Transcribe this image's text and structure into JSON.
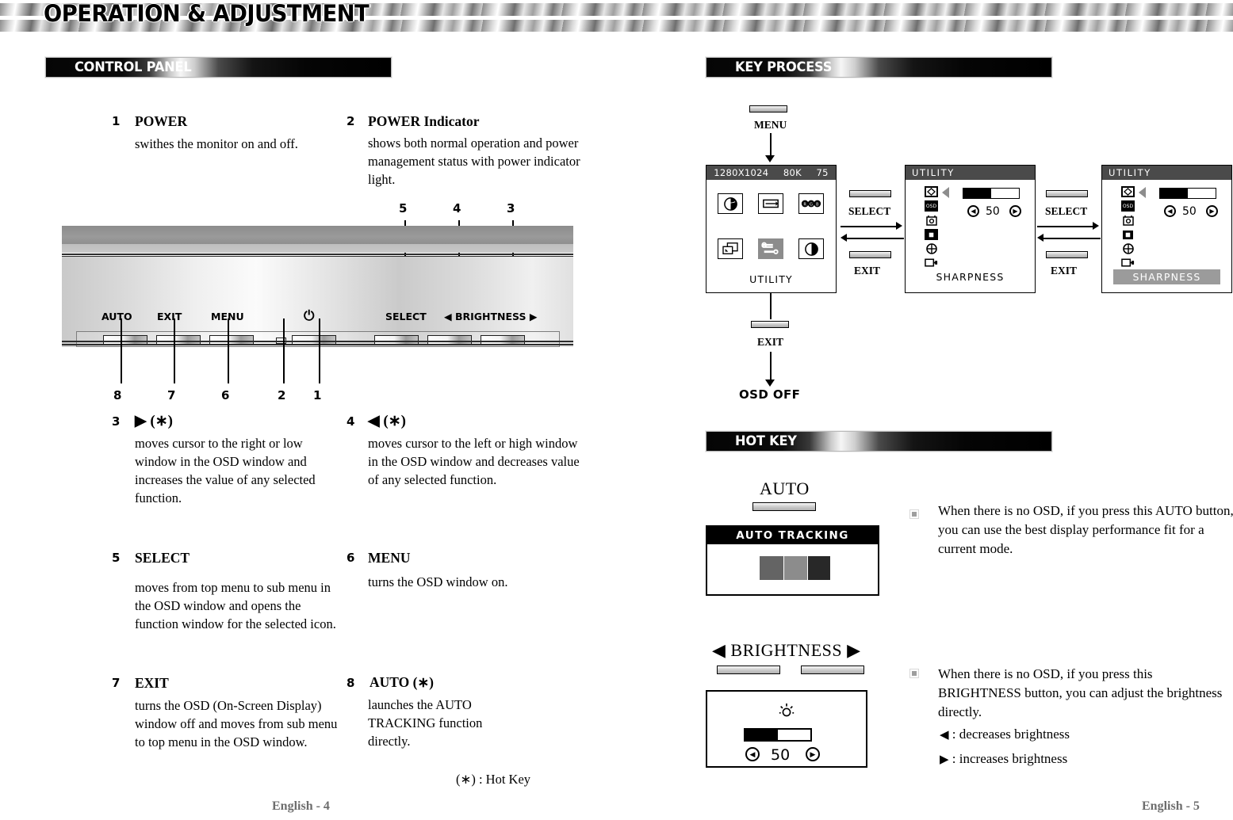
{
  "document": {
    "title": "OPERATION & ADJUSTMENT",
    "left_footer": "English - 4",
    "right_footer": "English - 5"
  },
  "sections": {
    "control_panel": "CONTROL PANEL",
    "key_process": "KEY PROCESS",
    "hot_key": "HOT KEY"
  },
  "control_panel": {
    "items": [
      {
        "num": "1",
        "title": "POWER",
        "body": "swithes the monitor on and off."
      },
      {
        "num": "2",
        "title": "POWER Indicator",
        "body": "shows both normal operation and power management status with power indicator light."
      },
      {
        "num": "3",
        "title": "▶  (∗)",
        "body": "moves cursor to the right  or low window in the OSD window and  increases the value of any selected function."
      },
      {
        "num": "4",
        "title": "◀  (∗)",
        "body": "moves cursor to the left or high window in the OSD window and  decreases value of any selected  function."
      },
      {
        "num": "5",
        "title": "SELECT",
        "body": "moves from top menu to sub menu in the OSD window and opens the function window for the selected icon."
      },
      {
        "num": "6",
        "title": "MENU",
        "body": "turns the OSD window on."
      },
      {
        "num": "7",
        "title": "EXIT",
        "body": "turns the OSD (On-Screen Display) window off and moves from sub menu to top menu in the OSD window."
      },
      {
        "num": "8",
        "title": "AUTO  (∗)",
        "body": "launches the AUTO TRACKING function directly."
      }
    ],
    "hotkey_legend": "(∗) : Hot Key",
    "bezel_labels": [
      "AUTO",
      "EXIT",
      "MENU",
      "⏻",
      "SELECT",
      "◀  BRIGHTNESS  ▶"
    ],
    "callout_top": [
      "5",
      "4",
      "3"
    ],
    "callout_bottom": [
      "8",
      "7",
      "6",
      "2",
      "1"
    ]
  },
  "key_process": {
    "entry_key": "MENU",
    "exit_key": "EXIT",
    "osd_off": "OSD OFF",
    "transition_forward": "SELECT",
    "transition_back": "EXIT",
    "main_menu": {
      "status_resolution": "1280X1024",
      "status_hfreq": "80K",
      "status_vfreq": "75",
      "caption": "UTILITY",
      "icons": [
        "brightness-globe-icon",
        "h-size-icon",
        "rgb-color-icon",
        "position-window-icon",
        "utility-tools-icon",
        "contrast-icon"
      ],
      "selected_icon_index": 4
    },
    "sub_menu": {
      "title": "UTILITY",
      "caption": "SHARPNESS",
      "value": "50",
      "fill_percent": 50,
      "icons": [
        "sharpness-icon",
        "osd-icon",
        "osd-timer-icon",
        "dpms-icon",
        "recall-icon",
        "exit-icon"
      ],
      "selected_icon_index": 0
    },
    "function_window": {
      "title": "UTILITY",
      "caption": "SHARPNESS",
      "caption_highlighted": true,
      "value": "50",
      "fill_percent": 50,
      "icons": [
        "sharpness-icon",
        "osd-icon",
        "osd-timer-icon",
        "dpms-icon",
        "recall-icon",
        "exit-icon"
      ],
      "selected_icon_index": 1
    }
  },
  "hot_key": {
    "auto": {
      "heading": "AUTO",
      "panel_title": "AUTO TRACKING",
      "swatches": [
        "#646464",
        "#8c8c8c",
        "#282828"
      ],
      "note": "When there is no OSD, if you press this AUTO button, you can use the best display performance fit  for a current mode."
    },
    "brightness": {
      "heading": "◀ BRIGHTNESS ▶",
      "icon": "sun-brightness-icon",
      "value": "50",
      "fill_percent": 50,
      "note": "When there is no OSD, if you press this BRIGHTNESS button, you can adjust the brightness directly.",
      "legend": [
        {
          "glyph": "◀",
          "text": ":  decreases brightness"
        },
        {
          "glyph": "▶",
          "text": ":  increases brightness"
        }
      ]
    }
  }
}
